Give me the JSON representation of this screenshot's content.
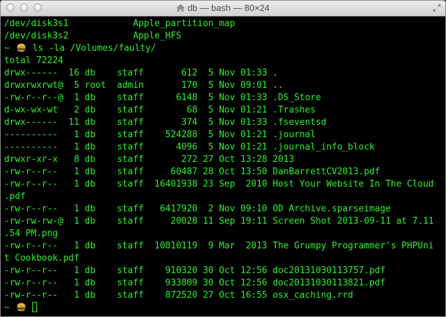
{
  "window": {
    "title": "db — bash — 80×24"
  },
  "terminal": {
    "prompt_prefix": "~",
    "lines": [
      "/dev/disk3s1            Apple_partition_map",
      "/dev/disk3s2            Apple_HFS",
      "PROMPT:ls -la /Volumes/faulty/",
      "total 72224",
      "drwx------  16 db    staff       612  5 Nov 01:33 .",
      "drwxrwxrwt@  5 root  admin       170  5 Nov 09:01 ..",
      "-rw-r--r--@  1 db    staff      6148  5 Nov 01:33 .DS_Store",
      "d-wx-wx-wt   2 db    staff        68  5 Nov 01:21 .Trashes",
      "drwx------  11 db    staff       374  5 Nov 01:33 .fseventsd",
      "----------   1 db    staff    524288  5 Nov 01:21 .journal",
      "----------   1 db    staff      4096  5 Nov 01:21 .journal_info_block",
      "drwxr-xr-x   8 db    staff       272 27 Oct 13:28 2013",
      "-rw-r--r--   1 db    staff     60487 28 Oct 13:50 DanBarrettCV2013.pdf",
      "-rw-r--r--   1 db    staff  16401938 23 Sep  2010 Host Your Website In The Cloud",
      ".pdf",
      "-rw-r--r--   1 db    staff   6417920  2 Nov 09:10 OD Archive.sparseimage",
      "-rw-rw-rw-@  1 db    staff     20028 11 Sep 19:11 Screen Shot 2013-09-11 at 7.11",
      ".54 PM.png",
      "-rw-r--r--   1 db    staff  10810119  9 Mar  2013 The Grumpy Programmer's PHPUni",
      "t Cookbook.pdf",
      "-rw-r--r--   1 db    staff    910320 30 Oct 12:56 doc20131030113757.pdf",
      "-rw-r--r--   1 db    staff    933809 30 Oct 12:56 doc20131030113821.pdf",
      "-rw-r--r--   1 db    staff    872520 27 Oct 16:55 osx_caching.rrd",
      "PROMPT:"
    ]
  }
}
